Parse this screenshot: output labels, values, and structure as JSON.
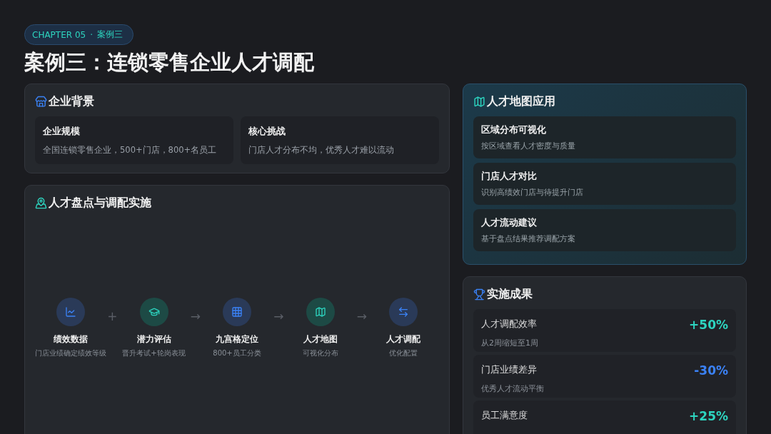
{
  "badge": {
    "chapter": "CHAPTER 05",
    "separator": "·",
    "case": "案例三"
  },
  "title": "案例三：连锁零售企业人才调配",
  "background": {
    "title": "企业背景",
    "items": [
      {
        "title": "企业规模",
        "text": "全国连锁零售企业，500+门店，800+名员工"
      },
      {
        "title": "核心挑战",
        "text": "门店人才分布不均，优秀人才难以流动"
      }
    ]
  },
  "process": {
    "title": "人才盘点与调配实施",
    "flow": [
      {
        "kind": "step",
        "title": "绩效数据",
        "text": "门店业绩确定绩效等级"
      },
      {
        "kind": "connector",
        "symbol": "+"
      },
      {
        "kind": "step",
        "title": "潜力评估",
        "text": "晋升考试+轮岗表现"
      },
      {
        "kind": "connector",
        "symbol": "→"
      },
      {
        "kind": "step",
        "title": "九宫格定位",
        "text": "800+员工分类"
      },
      {
        "kind": "connector",
        "symbol": "→"
      },
      {
        "kind": "step",
        "title": "人才地图",
        "text": "可视化分布"
      },
      {
        "kind": "connector",
        "symbol": "→"
      },
      {
        "kind": "step",
        "title": "人才调配",
        "text": "优化配置"
      }
    ]
  },
  "map_app": {
    "title": "人才地图应用",
    "items": [
      {
        "title": "区域分布可视化",
        "text": "按区域查看人才密度与质量"
      },
      {
        "title": "门店人才对比",
        "text": "识别高绩效门店与待提升门店"
      },
      {
        "title": "人才流动建议",
        "text": "基于盘点结果推荐调配方案"
      }
    ]
  },
  "results": {
    "title": "实施成果",
    "items": [
      {
        "label": "人才调配效率",
        "note": "从2周缩短至1周",
        "value": "+50%",
        "color": "#2dd4bf"
      },
      {
        "label": "门店业绩差异",
        "note": "优秀人才流动平衡",
        "value": "-30%",
        "color": "#3b82f6"
      },
      {
        "label": "员工满意度",
        "value": "+25%",
        "color": "#2dd4bf"
      }
    ]
  }
}
